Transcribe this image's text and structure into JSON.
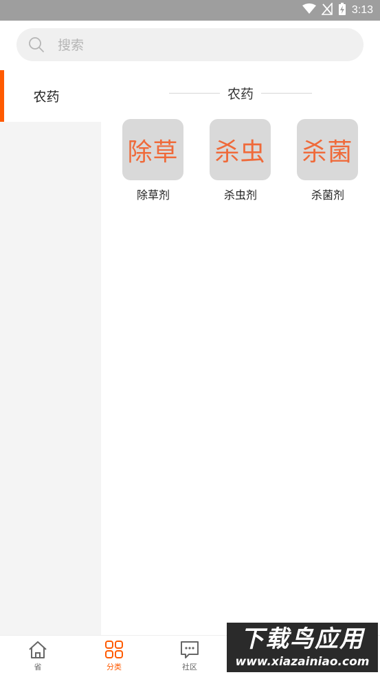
{
  "status_bar": {
    "time": "3:13",
    "icons": [
      "wifi-icon",
      "no-signal-icon",
      "battery-charging-icon"
    ]
  },
  "search": {
    "placeholder": "搜索",
    "value": ""
  },
  "sidebar": {
    "items": [
      {
        "label": "农药",
        "selected": true
      }
    ]
  },
  "content": {
    "section_title": "农药",
    "tiles": [
      {
        "glyph": "除草",
        "label": "除草剂"
      },
      {
        "glyph": "杀虫",
        "label": "杀虫剂"
      },
      {
        "glyph": "杀菌",
        "label": "杀菌剂"
      }
    ]
  },
  "bottom_nav": {
    "items": [
      {
        "label": "省",
        "icon": "home-icon",
        "active": false
      },
      {
        "label": "分类",
        "icon": "category-grid-icon",
        "active": true
      },
      {
        "label": "社区",
        "icon": "chat-bubble-icon",
        "active": false
      }
    ]
  },
  "watermark": {
    "title": "下载鸟应用",
    "url": "www.xiazainiao.com"
  },
  "colors": {
    "accent": "#ff5a00",
    "tile_glyph": "#ef6a3a",
    "tile_bg": "#d9d9d9",
    "status_bar": "#9e9e9e",
    "sidebar_bg": "#f4f4f4"
  }
}
